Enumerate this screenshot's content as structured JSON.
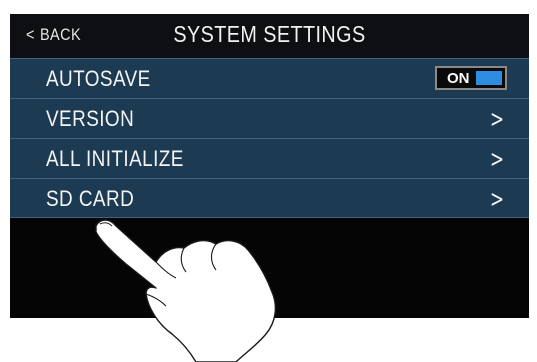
{
  "header": {
    "back_label": "BACK",
    "back_icon": "chevron-left-icon",
    "title": "SYSTEM SETTINGS"
  },
  "settings": [
    {
      "label": "AUTOSAVE",
      "type": "toggle",
      "value": "ON"
    },
    {
      "label": "VERSION",
      "type": "submenu",
      "icon": "chevron-right-icon"
    },
    {
      "label": "ALL INITIALIZE",
      "type": "submenu",
      "icon": "chevron-right-icon"
    },
    {
      "label": "SD CARD",
      "type": "submenu",
      "icon": "chevron-right-icon"
    }
  ],
  "colors": {
    "screen_bg": "#050505",
    "row_bg": "#1c3a52",
    "row_border": "#3f6280",
    "toggle_accent": "#2f8de0"
  },
  "overlay": {
    "icon": "pointing-hand-icon"
  }
}
